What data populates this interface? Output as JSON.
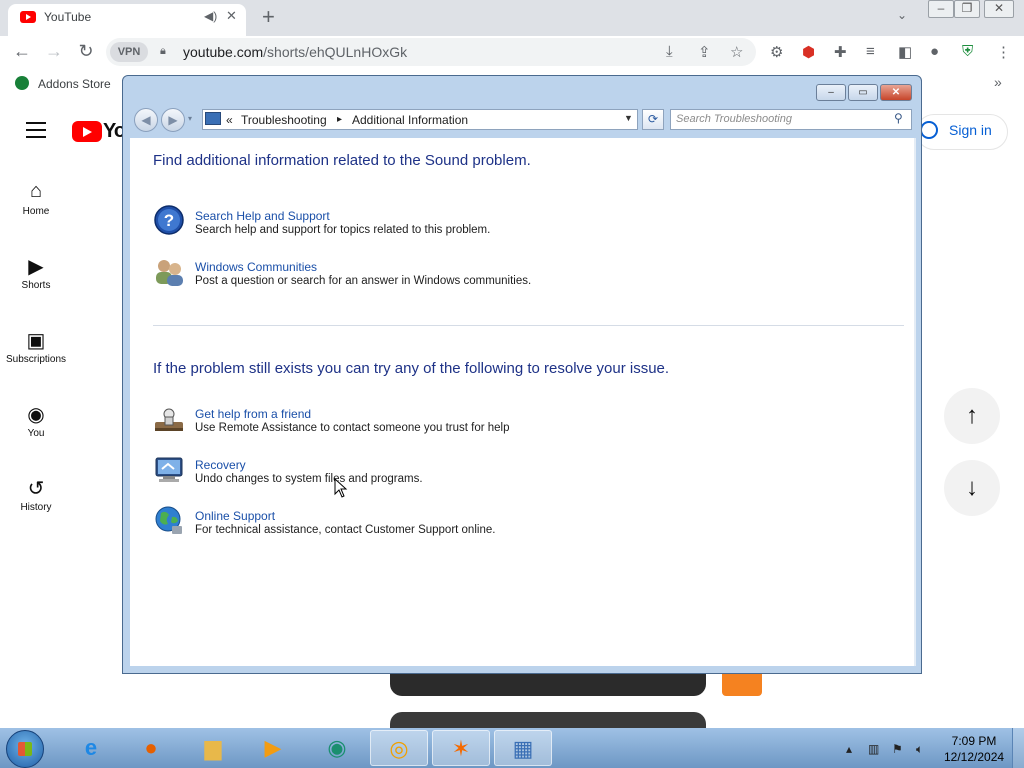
{
  "browser": {
    "tab_title": "YouTube",
    "audio_icon": "speaker-icon",
    "close_glyph": "✕",
    "newtab_glyph": "+",
    "url_host": "youtube.com",
    "url_path": "/shorts/ehQULnHOxGk",
    "vpn_label": "VPN",
    "bookmark_label": "Addons Store",
    "bookmarks_more": "»"
  },
  "youtube": {
    "logo_text": "Yo",
    "sidebar": [
      {
        "label": "Home",
        "icon": "⌂"
      },
      {
        "label": "Shorts",
        "icon": "▶"
      },
      {
        "label": "Subscriptions",
        "icon": "▣"
      },
      {
        "label": "You",
        "icon": "◉"
      },
      {
        "label": "History",
        "icon": "↺"
      }
    ],
    "signin_label": "Sign in",
    "up_arrow": "↑",
    "down_arrow": "↓"
  },
  "window": {
    "breadcrumb_prefix": "«",
    "crumb1": "Troubleshooting",
    "crumb_sep": "▸",
    "crumb2": "Additional Information",
    "search_placeholder": "Search Troubleshooting",
    "heading1": "Find additional information related to the Sound problem.",
    "heading2": "If the problem still exists you can try any of the following to resolve your issue.",
    "items_top": [
      {
        "title": "Search Help and Support",
        "desc": "Search help and support for topics related to this problem.",
        "icon": "help-icon"
      },
      {
        "title": "Windows Communities",
        "desc": "Post a question or search for an answer in Windows communities.",
        "icon": "community-icon"
      }
    ],
    "items_bottom": [
      {
        "title": "Get help from a friend",
        "desc": "Use Remote Assistance to contact someone you trust for help",
        "icon": "remote-assistance-icon"
      },
      {
        "title": "Recovery",
        "desc": "Undo changes to system files and programs.",
        "icon": "recovery-icon"
      },
      {
        "title": "Online Support",
        "desc": "For technical assistance, contact Customer Support online.",
        "icon": "globe-icon"
      }
    ]
  },
  "taskbar": {
    "time": "7:09 PM",
    "date": "12/12/2024"
  }
}
